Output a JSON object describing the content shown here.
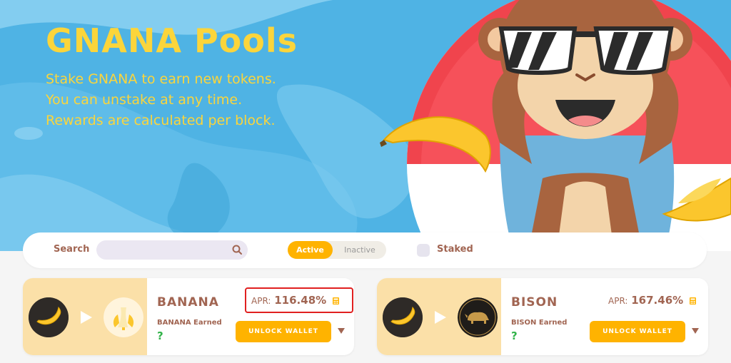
{
  "hero": {
    "title": "GNANA Pools",
    "description": [
      "Stake GNANA to earn new tokens.",
      "You can unstake at any time.",
      "Rewards are calculated per block."
    ],
    "mascot_icon": "monkey-sunglasses-banana-mascot",
    "title_color": "#fbd53b",
    "background_color": "#4fb3e4"
  },
  "filters": {
    "search_label": "Search",
    "search_value": "",
    "search_placeholder": "",
    "active_label": "Active",
    "inactive_label": "Inactive",
    "selected": "Active",
    "staked_label": "Staked",
    "staked_checked": false
  },
  "pools": [
    {
      "name": "BANANA",
      "stake_token_icon": "banana-icon",
      "earn_token_icon": "peeled-banana-icon",
      "earned_label": "BANANA Earned",
      "earned_value": "?",
      "apr_label": "APR:",
      "apr_value": "116.48%",
      "apr_calculator_icon": "calculator-icon",
      "button_label": "UNLOCK WALLET",
      "highlighted": true
    },
    {
      "name": "BISON",
      "stake_token_icon": "banana-icon",
      "earn_token_icon": "bison-icon",
      "earned_label": "BISON Earned",
      "earned_value": "?",
      "apr_label": "APR:",
      "apr_value": "167.46%",
      "apr_calculator_icon": "calculator-icon",
      "button_label": "UNLOCK WALLET",
      "highlighted": false
    }
  ],
  "colors": {
    "accent": "#ffb300",
    "text_brown": "#a16552",
    "earned_green": "#32b34a",
    "highlight_red": "#e02020",
    "card_left_bg": "#fbe0a8"
  }
}
